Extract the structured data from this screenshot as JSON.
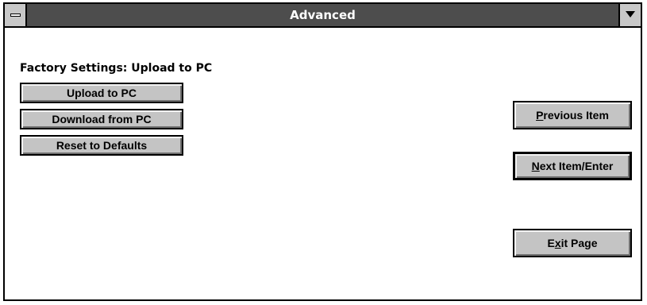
{
  "window": {
    "title": "Advanced"
  },
  "main": {
    "status_label": "Factory Settings: Upload to PC",
    "buttons": {
      "upload": "Upload to PC",
      "download": "Download from PC",
      "reset": "Reset to Defaults"
    }
  },
  "nav": {
    "previous": {
      "mnemonic": "P",
      "rest": "revious Item"
    },
    "next": {
      "mnemonic": "N",
      "rest": "ext Item/Enter"
    },
    "exit": {
      "pre": "E",
      "mnemonic": "x",
      "post": "it Page"
    }
  },
  "icons": {
    "system_menu": "dash-icon",
    "minimize": "down-arrow-icon"
  },
  "colors": {
    "titlebar": "#4d4d4d",
    "button_face": "#c4c4c4",
    "window_bg": "#ffffff"
  }
}
